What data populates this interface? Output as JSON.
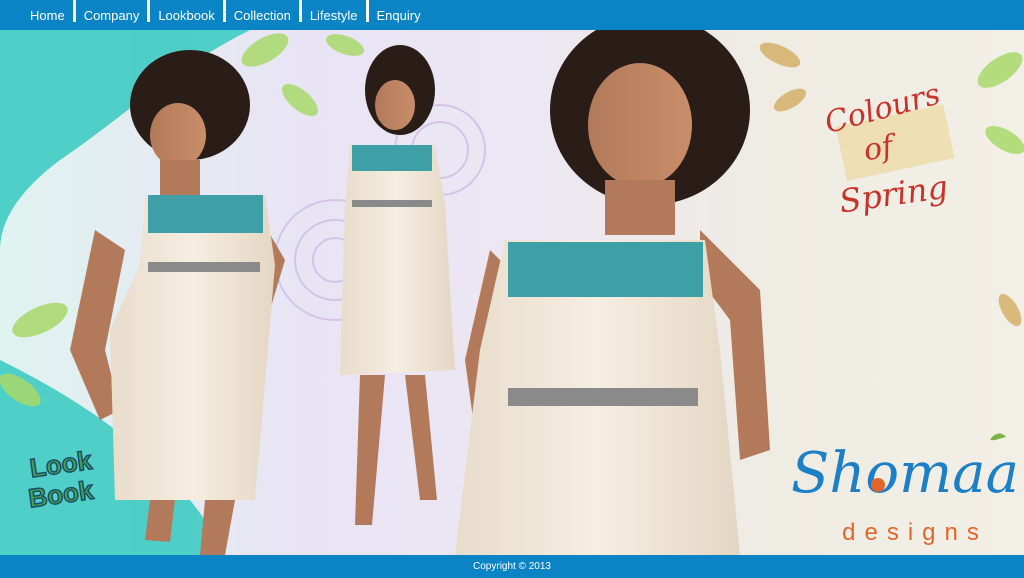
{
  "nav": {
    "items": [
      {
        "label": "Home"
      },
      {
        "label": "Company"
      },
      {
        "label": "Lookbook"
      },
      {
        "label": "Collection"
      },
      {
        "label": "Lifestyle"
      },
      {
        "label": "Enquiry"
      }
    ]
  },
  "banner": {
    "lookbook_badge": [
      "Look",
      "Book"
    ],
    "tagline": [
      "Colours",
      "of",
      "Spring"
    ],
    "brand": {
      "name": "Shomaa",
      "sub": "designs"
    },
    "colors": {
      "nav": "#0a84c4",
      "turquoise": "#35c9c1",
      "leaf_green": "#a8d86a",
      "brand_blue": "#1d7fc6",
      "brand_orange": "#e2662b",
      "tagline_red": "#c8322a"
    }
  },
  "footer": {
    "copyright": "Copyright © 2013"
  }
}
